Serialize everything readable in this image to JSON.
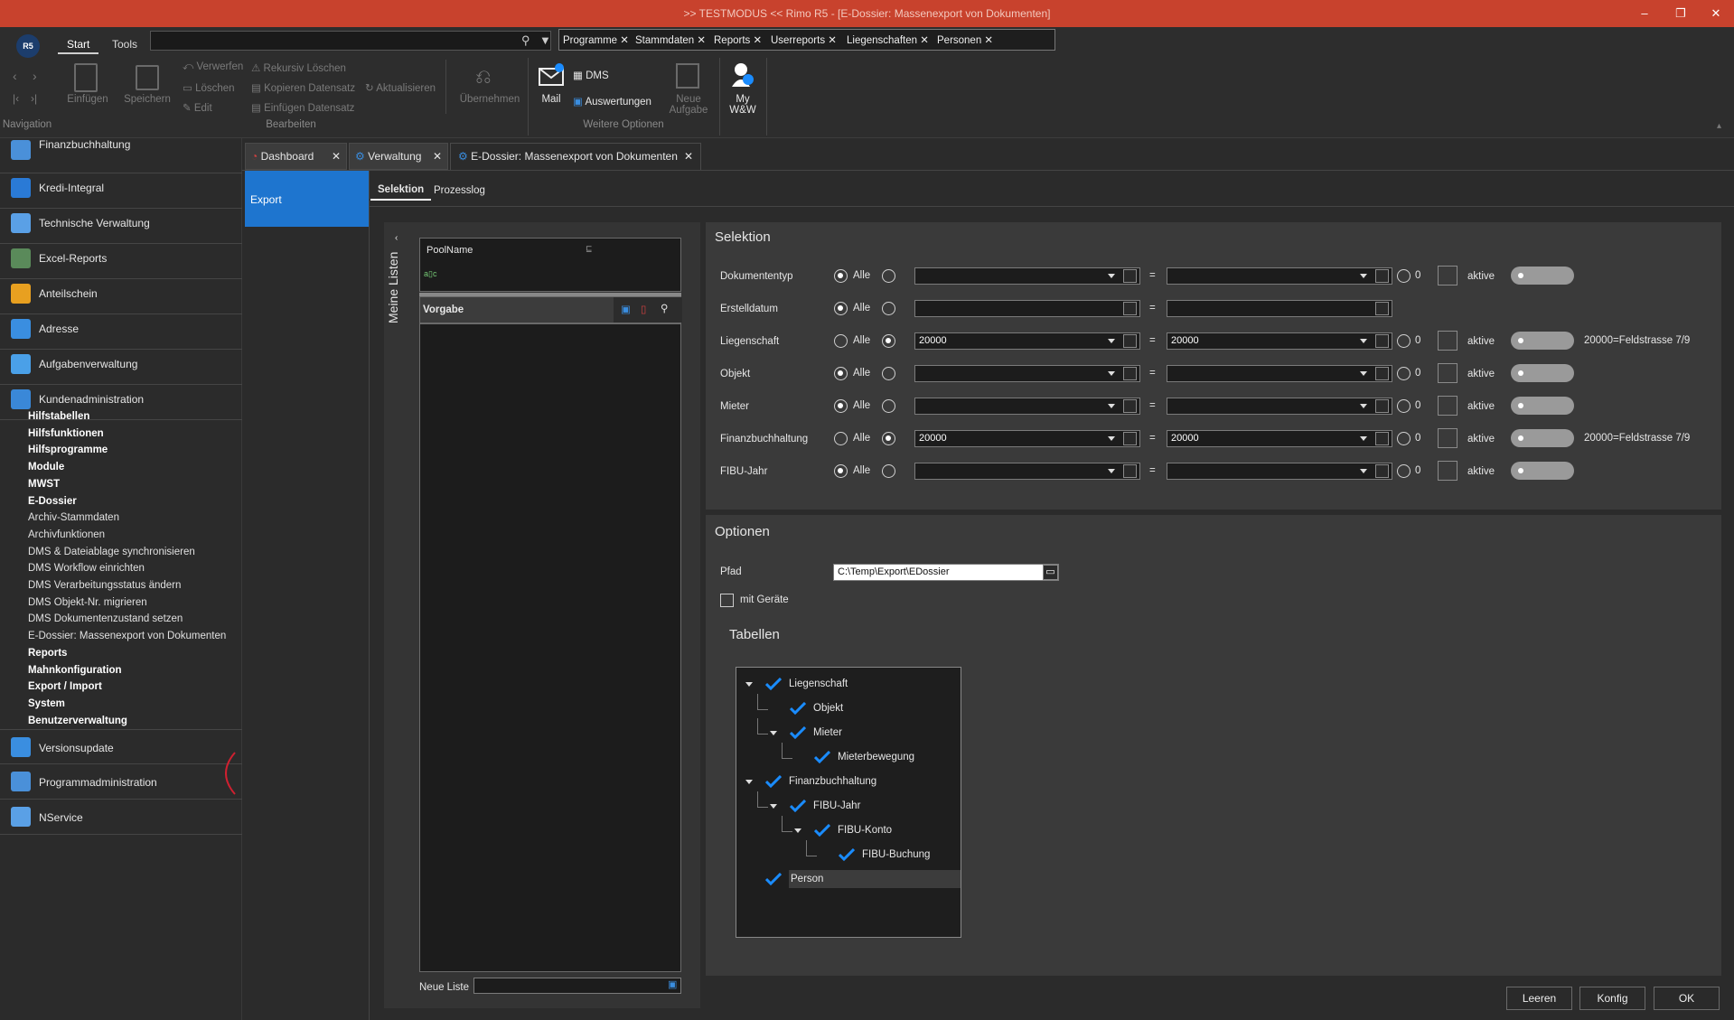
{
  "window": {
    "title": ">> TESTMODUS << Rimo R5 - [E-Dossier: Massenexport von Dokumenten]",
    "minimize": "–",
    "restore": "❐",
    "close": "✕"
  },
  "app": {
    "logo": "R5"
  },
  "ribbon": {
    "tabs": [
      "Start",
      "Tools"
    ],
    "filter_chips": [
      "Programme",
      "Stammdaten",
      "Reports",
      "Userreports",
      "Liegenschaften",
      "Personen"
    ],
    "navigation_group": "Navigation",
    "einfuegen": "Einfügen",
    "speichern": "Speichern",
    "verwerfen": "Verwerfen",
    "loeschen": "Löschen",
    "edit": "Edit",
    "rekursiv_loeschen": "Rekursiv Löschen",
    "kopieren_datensatz": "Kopieren Datensatz",
    "einfuegen_datensatz": "Einfügen Datensatz",
    "aktualisieren": "Aktualisieren",
    "uebernehmen": "Übernehmen",
    "bearbeiten_group": "Bearbeiten",
    "mail": "Mail",
    "dms": "DMS",
    "auswertungen": "Auswertungen",
    "neue_aufgabe_1": "Neue",
    "neue_aufgabe_2": "Aufgabe",
    "weitere_optionen": "Weitere Optionen",
    "my_ww_1": "My",
    "my_ww_2": "W&W"
  },
  "sidebar": {
    "modules": [
      {
        "label": "Finanzbuchhaltung",
        "color": "#4a90d9"
      },
      {
        "label": "Kredi-Integral",
        "color": "#2a7ad6"
      },
      {
        "label": "Technische Verwaltung",
        "color": "#5aa0e6"
      },
      {
        "label": "Excel-Reports",
        "color": "#5a8a5a"
      },
      {
        "label": "Anteilschein",
        "color": "#e8a020"
      },
      {
        "label": "Adresse",
        "color": "#3a8ee0"
      },
      {
        "label": "Aufgabenverwaltung",
        "color": "#4aa0e8"
      },
      {
        "label": "Kundenadministration",
        "color": "#3a88d8"
      }
    ],
    "sub_items": [
      {
        "label": "Hilfstabellen",
        "bold": true
      },
      {
        "label": "Hilfsfunktionen",
        "bold": true
      },
      {
        "label": "Hilfsprogramme",
        "bold": true
      },
      {
        "label": "Module",
        "bold": true
      },
      {
        "label": "MWST",
        "bold": true
      },
      {
        "label": "E-Dossier",
        "bold": true
      },
      {
        "label": "Archiv-Stammdaten",
        "bold": false
      },
      {
        "label": "Archivfunktionen",
        "bold": false
      },
      {
        "label": "DMS & Dateiablage synchronisieren",
        "bold": false
      },
      {
        "label": "DMS Workflow einrichten",
        "bold": false
      },
      {
        "label": "DMS Verarbeitungsstatus ändern",
        "bold": false
      },
      {
        "label": "DMS Objekt-Nr. migrieren",
        "bold": false
      },
      {
        "label": "DMS Dokumentenzustand setzen",
        "bold": false
      },
      {
        "label": "E-Dossier: Massenexport von Dokumenten",
        "bold": false
      },
      {
        "label": "Reports",
        "bold": true
      },
      {
        "label": "Mahnkonfiguration",
        "bold": true
      },
      {
        "label": "Export / Import",
        "bold": true
      },
      {
        "label": "System",
        "bold": true
      },
      {
        "label": "Benutzerverwaltung",
        "bold": true
      }
    ],
    "bottom_modules": [
      {
        "label": "Versionsupdate",
        "color": "#3a8ee0"
      },
      {
        "label": "Programmadministration",
        "color": "#4a90d9"
      },
      {
        "label": "NService",
        "color": "#5aa0e6"
      }
    ]
  },
  "doc_tabs": [
    {
      "label": "Dashboard"
    },
    {
      "label": "Verwaltung"
    },
    {
      "label": "E-Dossier: Massenexport von Dokumenten"
    }
  ],
  "left_nav": {
    "export": "Export"
  },
  "sub_tabs": {
    "selektion": "Selektion",
    "prozesslog": "Prozesslog"
  },
  "meine_listen": {
    "vertical_label": "Meine Listen",
    "pool_header": "PoolName",
    "vorgabe": "Vorgabe",
    "neue_liste_label": "Neue Liste",
    "neue_liste_value": ""
  },
  "selektion": {
    "title": "Selektion",
    "alle": "Alle",
    "zero": "0",
    "aktive": "aktive",
    "eq": "=",
    "rows": [
      {
        "label": "Dokumententyp",
        "from": "",
        "to": "",
        "alle": true,
        "hint": "",
        "type": "combo",
        "extra": true
      },
      {
        "label": "Erstelldatum",
        "from": "",
        "to": "",
        "alle": true,
        "hint": "",
        "type": "date",
        "extra": false
      },
      {
        "label": "Liegenschaft",
        "from": "20000",
        "to": "20000",
        "alle": false,
        "hint": "20000=Feldstrasse 7/9",
        "type": "combo",
        "extra": true
      },
      {
        "label": "Objekt",
        "from": "",
        "to": "",
        "alle": true,
        "hint": "",
        "type": "combo",
        "extra": true
      },
      {
        "label": "Mieter",
        "from": "",
        "to": "",
        "alle": true,
        "hint": "",
        "type": "combo",
        "extra": true
      },
      {
        "label": "Finanzbuchhaltung",
        "from": "20000",
        "to": "20000",
        "alle": false,
        "hint": "20000=Feldstrasse 7/9",
        "type": "combo",
        "extra": true
      },
      {
        "label": "FIBU-Jahr",
        "from": "",
        "to": "",
        "alle": true,
        "hint": "",
        "type": "combo",
        "extra": true
      }
    ]
  },
  "optionen": {
    "title": "Optionen",
    "pfad_label": "Pfad",
    "pfad_value": "C:\\Temp\\Export\\EDossier",
    "mit_geraete": "mit Geräte",
    "tabellen_title": "Tabellen",
    "tree": [
      {
        "label": "Liegenschaft",
        "level": 0,
        "expander": true
      },
      {
        "label": "Objekt",
        "level": 1,
        "expander": false
      },
      {
        "label": "Mieter",
        "level": 1,
        "expander": true
      },
      {
        "label": "Mieterbewegung",
        "level": 2,
        "expander": false
      },
      {
        "label": "Finanzbuchhaltung",
        "level": 0,
        "expander": true
      },
      {
        "label": "FIBU-Jahr",
        "level": 1,
        "expander": true
      },
      {
        "label": "FIBU-Konto",
        "level": 2,
        "expander": true
      },
      {
        "label": "FIBU-Buchung",
        "level": 3,
        "expander": false
      },
      {
        "label": "Person",
        "level": 0,
        "expander": false
      }
    ]
  },
  "buttons": {
    "leeren": "Leeren",
    "konfig": "Konfig",
    "ok": "OK"
  },
  "colors": {
    "titlebar": "#c8422d",
    "accent": "#1e75cf",
    "check": "#1a8cff"
  }
}
